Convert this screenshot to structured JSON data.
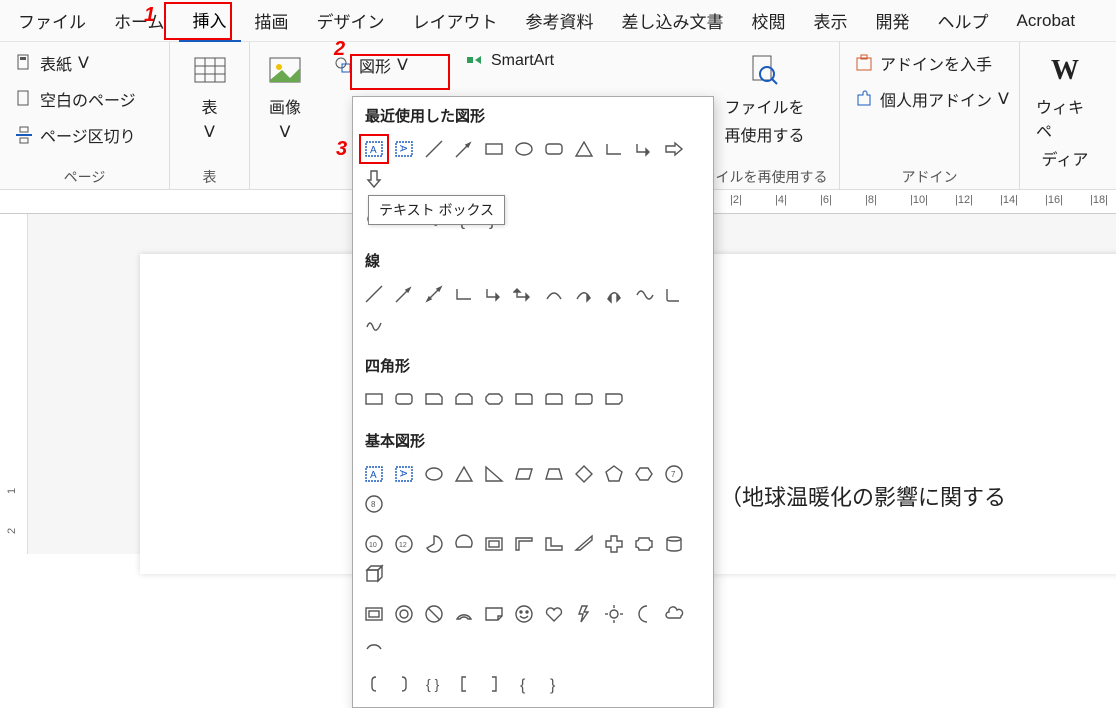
{
  "menubar": {
    "tabs": [
      "ファイル",
      "ホーム",
      "挿入",
      "描画",
      "デザイン",
      "レイアウト",
      "参考資料",
      "差し込み文書",
      "校閲",
      "表示",
      "開発",
      "ヘルプ",
      "Acrobat"
    ],
    "active_index": 2
  },
  "annotations": {
    "n1": "1",
    "n2": "2",
    "n3": "3"
  },
  "ribbon": {
    "pages": {
      "cover": "表紙",
      "blank": "空白のページ",
      "break": "ページ区切り",
      "label": "ページ"
    },
    "tables": {
      "btn": "表",
      "label": "表"
    },
    "images": {
      "btn": "画像"
    },
    "shapes_btn": "図形",
    "smartart": "SmartArt",
    "reuse": {
      "btn_l1": "ファイルを",
      "btn_l2": "再使用する",
      "label": "ァイルを再使用する"
    },
    "addins": {
      "get": "アドインを入手",
      "my": "個人用アドイン",
      "label": "アドイン"
    },
    "wiki": {
      "l1": "ウィキペ",
      "l2": "ディア"
    }
  },
  "shapes_panel": {
    "recent_title": "最近使用した図形",
    "lines_title": "線",
    "rects_title": "四角形",
    "basic_title": "基本図形"
  },
  "tooltip": "テキスト ボックス",
  "ruler_marks": [
    "|2|",
    "|4|",
    "|6|",
    "|8|",
    "|10|",
    "|12|",
    "|14|",
    "|16|",
    "|18|"
  ],
  "vruler_marks": [
    "1",
    "2"
  ],
  "document_text": "（地球温暖化の影響に関する"
}
